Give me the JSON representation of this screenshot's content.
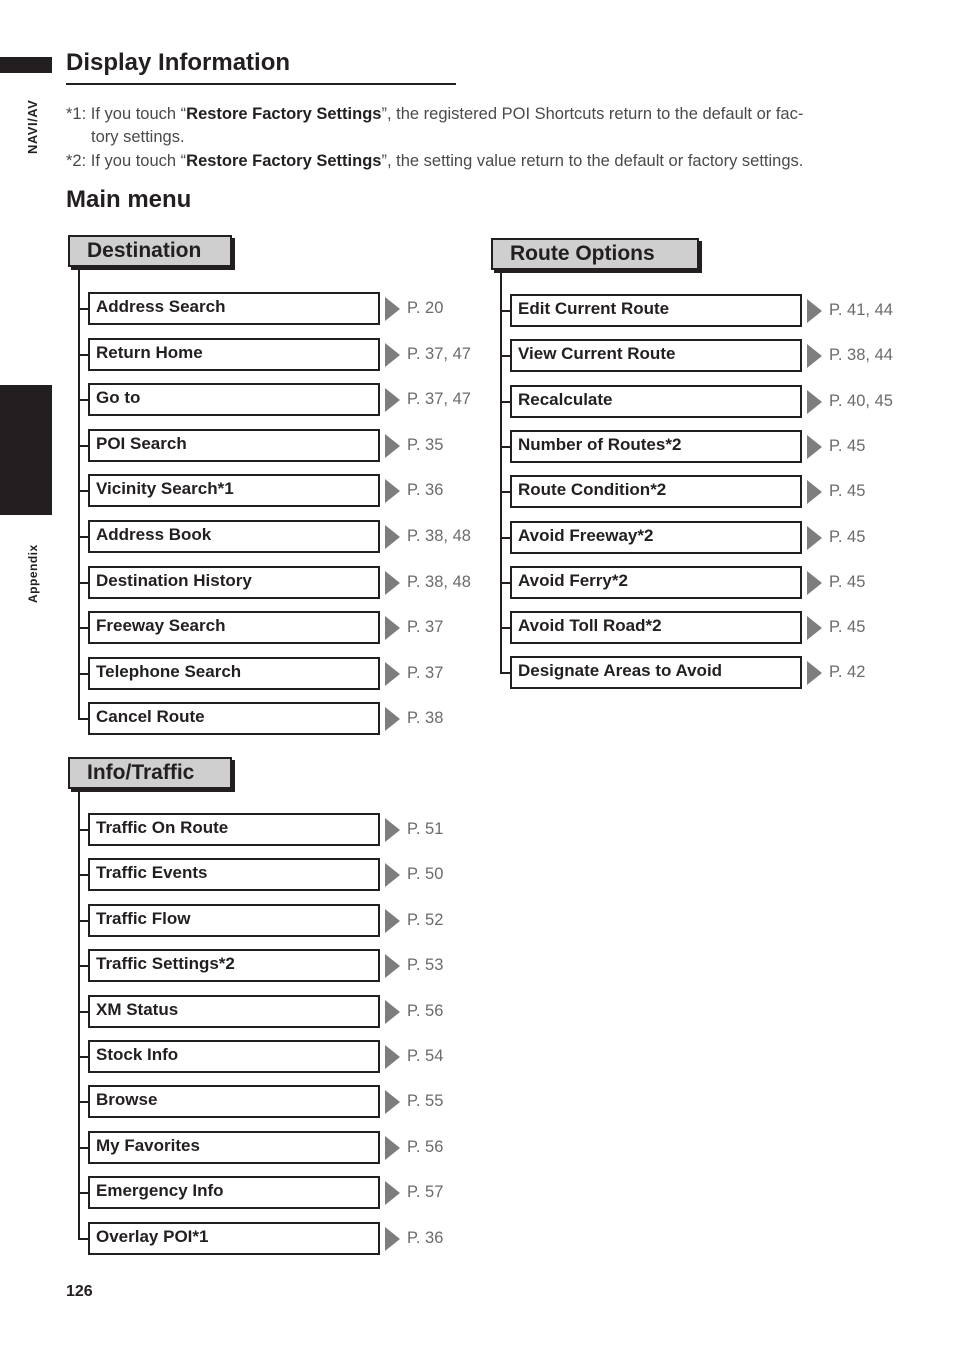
{
  "side_tabs": {
    "top_label": "NAVI/AV",
    "bottom_label": "Appendix"
  },
  "section_title": "Display Information",
  "notes": [
    {
      "prefix": "*1: If you touch “",
      "bold": "Restore Factory Settings",
      "suffix": "”, the registered POI Shortcuts return to the default or fac-",
      "continuation": "tory settings."
    },
    {
      "prefix": "*2: If you touch “",
      "bold": "Restore Factory Settings",
      "suffix": "”, the setting value return to the default or factory settings.",
      "continuation": ""
    }
  ],
  "subsection_title": "Main menu",
  "menus": {
    "destination": {
      "title": "Destination",
      "items": [
        {
          "label": "Address Search",
          "ref": "P. 20"
        },
        {
          "label": "Return Home",
          "ref": "P. 37, 47"
        },
        {
          "label": "Go to",
          "ref": "P. 37, 47"
        },
        {
          "label": "POI Search",
          "ref": "P. 35"
        },
        {
          "label": "Vicinity Search*1",
          "ref": "P. 36"
        },
        {
          "label": "Address Book",
          "ref": "P. 38, 48"
        },
        {
          "label": "Destination History",
          "ref": "P. 38, 48"
        },
        {
          "label": "Freeway Search",
          "ref": "P. 37"
        },
        {
          "label": "Telephone Search",
          "ref": "P. 37"
        },
        {
          "label": "Cancel Route",
          "ref": "P. 38"
        }
      ]
    },
    "route_options": {
      "title": "Route Options",
      "items": [
        {
          "label": "Edit Current Route",
          "ref": "P. 41, 44"
        },
        {
          "label": "View Current Route",
          "ref": "P. 38, 44"
        },
        {
          "label": "Recalculate",
          "ref": "P. 40, 45"
        },
        {
          "label": "Number of Routes*2",
          "ref": "P. 45"
        },
        {
          "label": "Route Condition*2",
          "ref": "P. 45"
        },
        {
          "label": "Avoid Freeway*2",
          "ref": "P. 45"
        },
        {
          "label": "Avoid Ferry*2",
          "ref": "P. 45"
        },
        {
          "label": "Avoid Toll Road*2",
          "ref": "P. 45"
        },
        {
          "label": "Designate Areas to Avoid",
          "ref": "P. 42"
        }
      ]
    },
    "info_traffic": {
      "title": "Info/Traffic",
      "items": [
        {
          "label": "Traffic On Route",
          "ref": "P. 51"
        },
        {
          "label": "Traffic Events",
          "ref": "P. 50"
        },
        {
          "label": "Traffic Flow",
          "ref": "P. 52"
        },
        {
          "label": "Traffic Settings*2",
          "ref": "P. 53"
        },
        {
          "label": "XM Status",
          "ref": "P. 56"
        },
        {
          "label": "Stock Info",
          "ref": "P. 54"
        },
        {
          "label": "Browse",
          "ref": "P. 55"
        },
        {
          "label": "My Favorites",
          "ref": "P. 56"
        },
        {
          "label": "Emergency Info",
          "ref": "P. 57"
        },
        {
          "label": "Overlay POI*1",
          "ref": "P. 36"
        }
      ]
    }
  },
  "page_number": "126"
}
